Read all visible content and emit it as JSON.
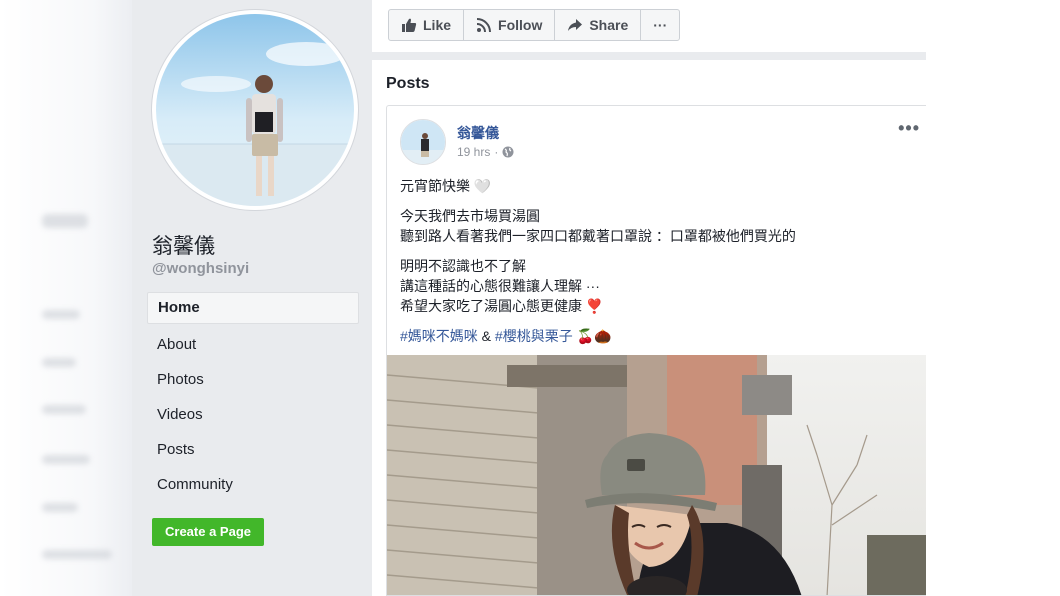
{
  "sidebar": {
    "page_name": "翁馨儀",
    "page_handle": "@wonghsinyi",
    "nav": [
      {
        "label": "Home",
        "active": true
      },
      {
        "label": "About"
      },
      {
        "label": "Photos"
      },
      {
        "label": "Videos"
      },
      {
        "label": "Posts"
      },
      {
        "label": "Community"
      }
    ],
    "create_page_label": "Create a Page"
  },
  "action_bar": {
    "like_label": "Like",
    "follow_label": "Follow",
    "share_label": "Share",
    "more_label": "···"
  },
  "posts_section": {
    "title": "Posts"
  },
  "post": {
    "author": "翁馨儀",
    "time": "19 hrs",
    "separator": "·",
    "more_label": "•••",
    "lines": {
      "line1": "元宵節快樂 🤍",
      "line2": "今天我們去市場買湯圓",
      "line3": "聽到路人看著我們一家四口都戴著口罩說 ：口罩都被他們買光的",
      "line4": "明明不認識也不了解",
      "line5": "講這種話的心態很難讓人理解 ···",
      "line6": "希望大家吃了湯圓心態更健康 ❣️"
    },
    "hashtag1": "#媽咪不媽咪",
    "amp": " & ",
    "hashtag2": "#櫻桃與栗子",
    "emoji": " 🍒🌰"
  },
  "colors": {
    "link_blue": "#365899",
    "green_button": "#42b72a",
    "page_bg": "#e9ebee"
  }
}
